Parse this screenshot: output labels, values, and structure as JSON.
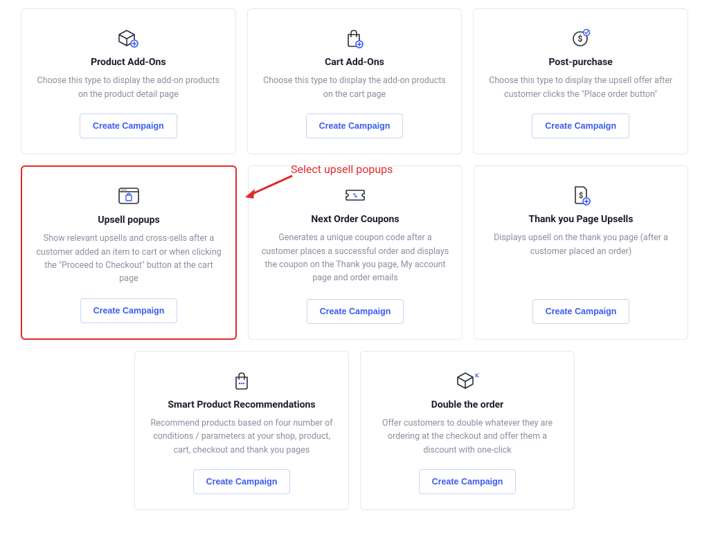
{
  "button_label": "Create Campaign",
  "annotation": "Select upsell popups",
  "cards": [
    {
      "title": "Product Add-Ons",
      "desc": "Choose this type to display the add-on products on the product detail page",
      "icon": "box-plus"
    },
    {
      "title": "Cart Add-Ons",
      "desc": "Choose this type to display the add-on products on the cart page",
      "icon": "bag-plus"
    },
    {
      "title": "Post-purchase",
      "desc": "Choose this type to display the upsell offer after customer clicks the \"Place order button\"",
      "icon": "dollar-check"
    },
    {
      "title": "Upsell popups",
      "desc": "Show relevant upsells and cross-sells after a customer added an item to cart or when clicking the \"Proceed to Checkout\" button at the cart page",
      "icon": "popup-bag",
      "highlight": true
    },
    {
      "title": "Next Order Coupons",
      "desc": "Generates a unique coupon code after a customer places a successful order and displays the coupon on the Thank you page, My account page and order emails",
      "icon": "coupon"
    },
    {
      "title": "Thank you Page Upsells",
      "desc": "Displays upsell on the thank you page (after a customer placed an order)",
      "icon": "page-dollar-plus"
    },
    {
      "title": "Smart Product Recommendations",
      "desc": "Recommend products based on four number of conditions / parameters at your shop, product, cart, checkout and thank you pages",
      "icon": "bag-dots"
    },
    {
      "title": "Double the order",
      "desc": "Offer customers to double whatever they are ordering at the checkout and offer them a discount with one-click",
      "icon": "box-x2"
    }
  ]
}
